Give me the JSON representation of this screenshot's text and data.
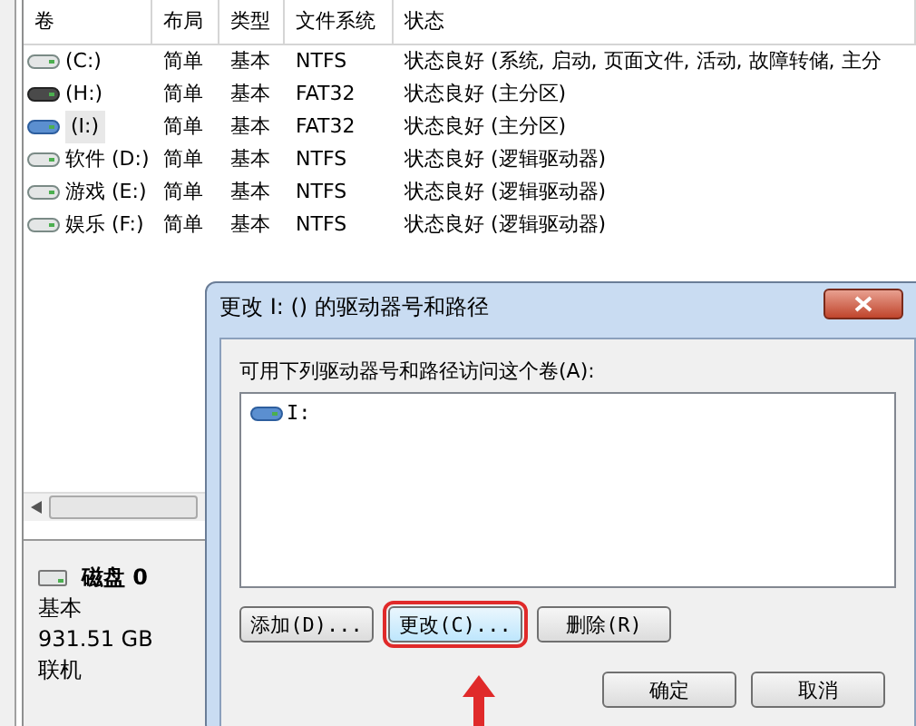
{
  "table": {
    "columns": [
      "卷",
      "布局",
      "类型",
      "文件系统",
      "状态"
    ],
    "rows": [
      {
        "kind": "disk",
        "cells": [
          "(C:)",
          "简单",
          "基本",
          "NTFS",
          "状态良好 (系统, 启动, 页面文件, 活动, 故障转储, 主分"
        ],
        "selected": false
      },
      {
        "kind": "card",
        "cells": [
          "(H:)",
          "简单",
          "基本",
          "FAT32",
          "状态良好 (主分区)"
        ],
        "selected": false
      },
      {
        "kind": "usb",
        "cells": [
          "(I:)",
          "简单",
          "基本",
          "FAT32",
          "状态良好 (主分区)"
        ],
        "selected": true
      },
      {
        "kind": "disk",
        "cells": [
          "软件 (D:)",
          "简单",
          "基本",
          "NTFS",
          "状态良好 (逻辑驱动器)"
        ],
        "selected": false
      },
      {
        "kind": "disk",
        "cells": [
          "游戏 (E:)",
          "简单",
          "基本",
          "NTFS",
          "状态良好 (逻辑驱动器)"
        ],
        "selected": false
      },
      {
        "kind": "disk",
        "cells": [
          "娱乐 (F:)",
          "简单",
          "基本",
          "NTFS",
          "状态良好 (逻辑驱动器)"
        ],
        "selected": false
      }
    ]
  },
  "disk": {
    "name": "磁盘 0",
    "lines": [
      "基本",
      "931.51 GB",
      "联机"
    ]
  },
  "dialog": {
    "title": "更改 I: () 的驱动器号和路径",
    "label": "可用下列驱动器号和路径访问这个卷(A):",
    "items": [
      {
        "label": "I:",
        "selected": false
      }
    ],
    "buttons": [
      {
        "label": "添加(D)...",
        "highlighted": false
      },
      {
        "label": "更改(C)...",
        "highlighted": true
      },
      {
        "label": "删除(R)",
        "highlighted": false
      }
    ],
    "footer_buttons": [
      "确定",
      "取消"
    ]
  }
}
